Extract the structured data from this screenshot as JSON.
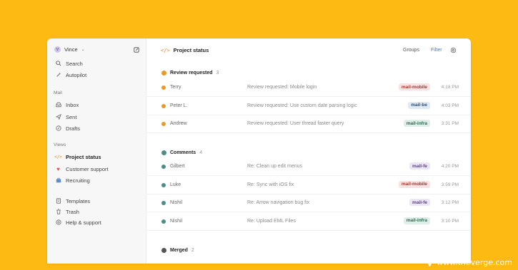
{
  "sidebar": {
    "user": {
      "initial": "V",
      "name": "Vince"
    },
    "top_items": [
      {
        "label": "Search",
        "icon": "search-icon"
      },
      {
        "label": "Autopilot",
        "icon": "autopilot-icon"
      }
    ],
    "mail_section": "Mail",
    "mail_items": [
      {
        "label": "Inbox",
        "icon": "inbox-icon"
      },
      {
        "label": "Sent",
        "icon": "sent-icon"
      },
      {
        "label": "Drafts",
        "icon": "drafts-icon"
      }
    ],
    "views_section": "Views",
    "view_items": [
      {
        "label": "Project status",
        "icon": "code-icon"
      },
      {
        "label": "Customer support",
        "icon": "heart-icon"
      },
      {
        "label": "Recruiting",
        "icon": "briefcase-icon"
      }
    ],
    "bottom_items": [
      {
        "label": "Templates",
        "icon": "template-icon"
      },
      {
        "label": "Trash",
        "icon": "trash-icon"
      },
      {
        "label": "Help & support",
        "icon": "help-icon"
      }
    ]
  },
  "header": {
    "title": "Project status",
    "groups_label": "Groups",
    "filter_label": "Filter"
  },
  "groups": [
    {
      "name": "Review requested",
      "count": "3",
      "color": "#E89A2C",
      "rows": [
        {
          "sender": "Terry",
          "subject": "Review requested: Mobile login",
          "tag": "mail-mobile",
          "time": "4:18 PM"
        },
        {
          "sender": "Peter L.",
          "subject": "Review requested: Use custom date parsing logic",
          "tag": "mail-be",
          "time": "4:03 PM"
        },
        {
          "sender": "Andrew",
          "subject": "Review requested: User thread faster query",
          "tag": "mail-infra",
          "time": "3:31 PM"
        }
      ]
    },
    {
      "name": "Comments",
      "count": "4",
      "color": "#4E8D86",
      "rows": [
        {
          "sender": "Gilbert",
          "subject": "Re: Clean up edit menus",
          "tag": "mail-fe",
          "time": "4:20 PM"
        },
        {
          "sender": "Luke",
          "subject": "Re: Sync with iOS fix",
          "tag": "mail-mobile",
          "time": "3:59 PM"
        },
        {
          "sender": "Nishil",
          "subject": "Re: Arrow navigation bug fix",
          "tag": "mail-fe",
          "time": "3:12 PM"
        },
        {
          "sender": "Nishil",
          "subject": "Re: Upload EML Files",
          "tag": "mail-infra",
          "time": "3:10 PM"
        }
      ]
    },
    {
      "name": "Merged",
      "count": "2",
      "color": "#555555",
      "rows": []
    }
  ],
  "tag_colors": {
    "mail-mobile": {
      "bg": "#FBE1E1",
      "fg": "#A3342F"
    },
    "mail-be": {
      "bg": "#E0EAF7",
      "fg": "#2D4F7E"
    },
    "mail-infra": {
      "bg": "#DDEFE6",
      "fg": "#2F6650"
    },
    "mail-fe": {
      "bg": "#ECE5F6",
      "fg": "#5B3F8C"
    }
  },
  "watermark": "www.theverge.com"
}
